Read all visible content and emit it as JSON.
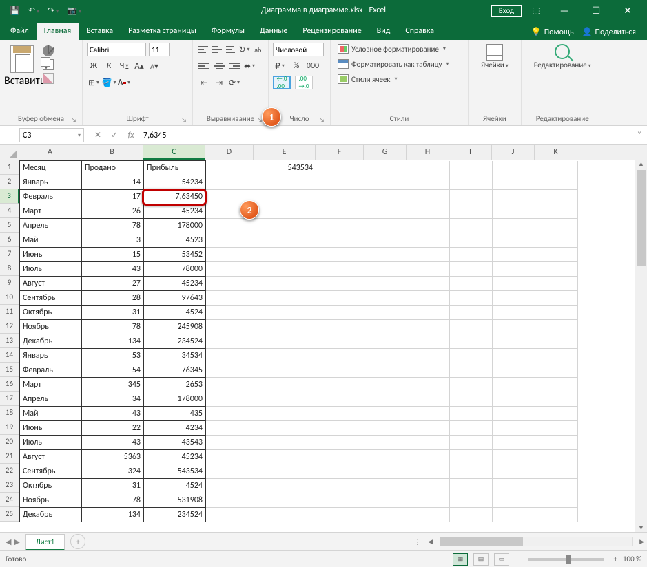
{
  "titlebar": {
    "title": "Диаграмма в диаграмме.xlsx  -  Excel",
    "signin": "Вход",
    "qat": {
      "save": "💾",
      "undo": "↶",
      "redo": "↷",
      "camera": "📷"
    }
  },
  "win": {
    "min": "—",
    "max": "☐",
    "close": "✕",
    "ribbonopts": "⬚"
  },
  "tabs": {
    "file": "Файл",
    "home": "Главная",
    "insert": "Вставка",
    "pagelayout": "Разметка страницы",
    "formulas": "Формулы",
    "data": "Данные",
    "review": "Рецензирование",
    "view": "Вид",
    "help": "Справка",
    "tellme": "Помощь",
    "share": "Поделиться"
  },
  "ribbon": {
    "clipboard": {
      "label": "Буфер обмена",
      "paste": "Вставить"
    },
    "font": {
      "label": "Шрифт",
      "name": "Calibri",
      "size": "11",
      "bold": "Ж",
      "italic": "К",
      "underline": "Ч",
      "incfont": "A",
      "decfont": "A"
    },
    "align": {
      "label": "Выравнивание",
      "wrap": "ab"
    },
    "number": {
      "label": "Число",
      "format": "Числовой",
      "currency": "₽",
      "percent": "%",
      "thousands": "000"
    },
    "styles": {
      "label": "Стили",
      "cf": "Условное форматирование",
      "tbl": "Форматировать как таблицу",
      "cs": "Стили ячеек"
    },
    "cells": {
      "label": "Ячейки",
      "btn": "Ячейки"
    },
    "editing": {
      "label": "Редактирование",
      "btn": "Редактирование"
    }
  },
  "fbar": {
    "cell": "C3",
    "cancel": "✕",
    "ok": "✓",
    "fx": "fx",
    "text": "7,6345",
    "expand": "˅"
  },
  "callouts": {
    "one": "1",
    "two": "2"
  },
  "cols": [
    "A",
    "B",
    "C",
    "D",
    "E",
    "F",
    "G",
    "H",
    "I",
    "J",
    "K"
  ],
  "rows": [
    "1",
    "2",
    "3",
    "4",
    "5",
    "6",
    "7",
    "8",
    "9",
    "10",
    "11",
    "12",
    "13",
    "14",
    "15",
    "16",
    "17",
    "18",
    "19",
    "20",
    "21",
    "22",
    "23",
    "24",
    "25"
  ],
  "headers": {
    "a": "Месяц",
    "b": "Продано",
    "c": "Прибыль"
  },
  "e1": "543534",
  "data": [
    {
      "a": "Январь",
      "b": "14",
      "c": "54234"
    },
    {
      "a": "Февраль",
      "b": "17",
      "c": "7,63450"
    },
    {
      "a": "Март",
      "b": "26",
      "c": "45234"
    },
    {
      "a": "Апрель",
      "b": "78",
      "c": "178000"
    },
    {
      "a": "Май",
      "b": "3",
      "c": "4523"
    },
    {
      "a": "Июнь",
      "b": "15",
      "c": "53452"
    },
    {
      "a": "Июль",
      "b": "43",
      "c": "78000"
    },
    {
      "a": "Август",
      "b": "27",
      "c": "45234"
    },
    {
      "a": "Сентябрь",
      "b": "28",
      "c": "97643"
    },
    {
      "a": "Октябрь",
      "b": "31",
      "c": "4524"
    },
    {
      "a": "Ноябрь",
      "b": "78",
      "c": "245908"
    },
    {
      "a": "Декабрь",
      "b": "134",
      "c": "234524"
    },
    {
      "a": "Январь",
      "b": "53",
      "c": "34534"
    },
    {
      "a": "Февраль",
      "b": "54",
      "c": "76345"
    },
    {
      "a": "Март",
      "b": "345",
      "c": "2653"
    },
    {
      "a": "Апрель",
      "b": "34",
      "c": "178000"
    },
    {
      "a": "Май",
      "b": "43",
      "c": "435"
    },
    {
      "a": "Июнь",
      "b": "22",
      "c": "4234"
    },
    {
      "a": "Июль",
      "b": "43",
      "c": "43543"
    },
    {
      "a": "Август",
      "b": "5363",
      "c": "45234"
    },
    {
      "a": "Сентябрь",
      "b": "324",
      "c": "543534"
    },
    {
      "a": "Октябрь",
      "b": "31",
      "c": "4524"
    },
    {
      "a": "Ноябрь",
      "b": "78",
      "c": "531908"
    },
    {
      "a": "Декабрь",
      "b": "134",
      "c": "234524"
    }
  ],
  "sheettabs": {
    "sheet1": "Лист1",
    "add": "+"
  },
  "status": {
    "ready": "Готово",
    "zoom": "100 %",
    "zoomout": "−",
    "zoomin": "+"
  }
}
